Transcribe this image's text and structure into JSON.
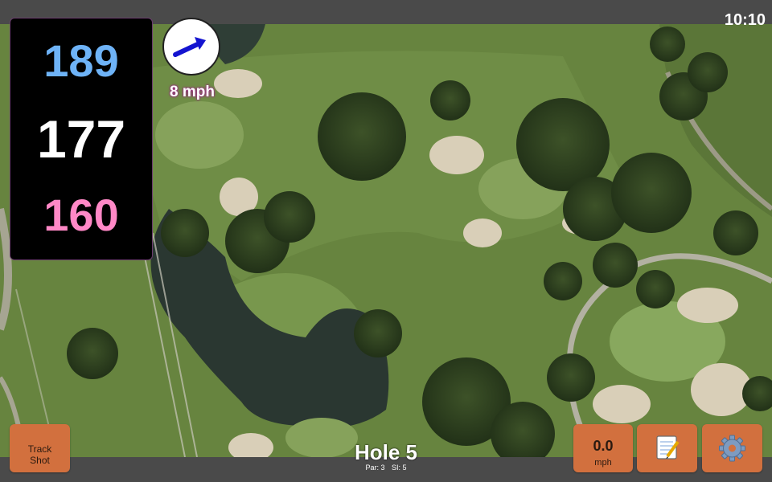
{
  "status": {
    "time": "10:10"
  },
  "distances": {
    "back": "189",
    "center": "177",
    "front": "160"
  },
  "wind": {
    "speed_label": "8 mph",
    "direction_icon": "wind-arrow-icon"
  },
  "buttons": {
    "track_shot_line1": "Track",
    "track_shot_line2": "Shot",
    "wind_speed_value": "0.0",
    "wind_speed_unit": "mph",
    "notes_icon": "notepad-icon",
    "settings_icon": "gear-icon"
  },
  "hole": {
    "title": "Hole 5",
    "par": "Par: 3",
    "si": "SI: 5"
  },
  "colors": {
    "back_distance": "#6eb3f7",
    "center_distance": "#ffffff",
    "front_distance": "#ff88c6",
    "button": "#d2703e",
    "bar": "#4a4a4a"
  }
}
